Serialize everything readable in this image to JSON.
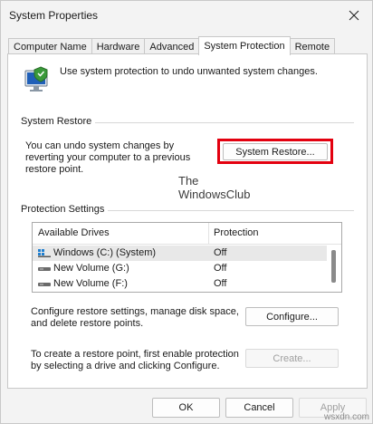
{
  "window": {
    "title": "System Properties"
  },
  "tabs": [
    {
      "label": "Computer Name",
      "active": false
    },
    {
      "label": "Hardware",
      "active": false
    },
    {
      "label": "Advanced",
      "active": false
    },
    {
      "label": "System Protection",
      "active": true
    },
    {
      "label": "Remote",
      "active": false
    }
  ],
  "intro": {
    "text": "Use system protection to undo unwanted system changes.",
    "icon": "monitor-shield-icon"
  },
  "system_restore": {
    "heading": "System Restore",
    "text": "You can undo system changes by reverting your computer to a previous restore point.",
    "button_label": "System Restore...",
    "highlight_color": "#e3000f"
  },
  "watermark": {
    "line1": "The",
    "line2": "WindowsClub"
  },
  "protection": {
    "heading": "Protection Settings",
    "columns": [
      "Available Drives",
      "Protection"
    ],
    "drives": [
      {
        "name": "Windows (C:) (System)",
        "protection": "Off",
        "icon": "windows-drive-icon"
      },
      {
        "name": "New Volume (G:)",
        "protection": "Off",
        "icon": "drive-icon"
      },
      {
        "name": "New Volume (F:)",
        "protection": "Off",
        "icon": "drive-icon"
      }
    ],
    "configure_text": "Configure restore settings, manage disk space, and delete restore points.",
    "configure_label": "Configure...",
    "create_text": "To create a restore point, first enable protection by selecting a drive and clicking Configure.",
    "create_label": "Create..."
  },
  "footer": {
    "ok": "OK",
    "cancel": "Cancel",
    "apply": "Apply"
  },
  "corner_mark": "wsxdn.com"
}
